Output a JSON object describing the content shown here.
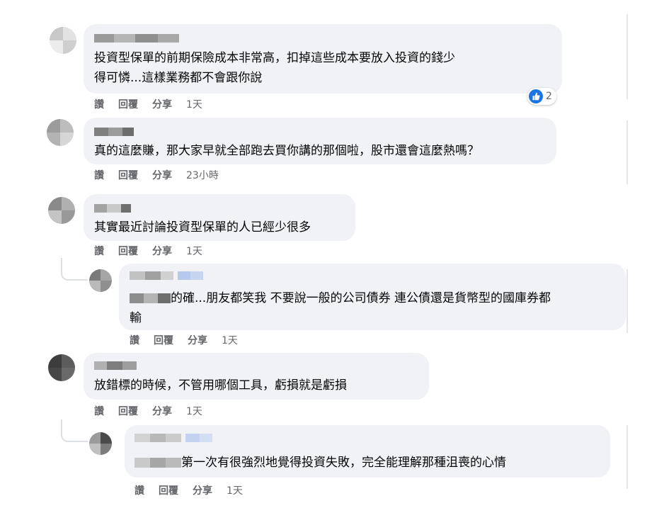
{
  "actions": {
    "like": "讚",
    "reply": "回覆",
    "share": "分享"
  },
  "comments": [
    {
      "text": "投資型保單的前期保險成本非常高，扣掉這些成本要放入投資的錢少\n得可憐...這樣業務都不會跟你說",
      "time": "1天",
      "reactions": {
        "icon": "thumbs-up-icon",
        "count": "2"
      }
    },
    {
      "text": "真的這麼賺，那大家早就全部跑去買你講的那個啦，股市還會這麼熱嗎？",
      "time": "23小時"
    },
    {
      "text": "其實最近討論投資型保單的人已經少很多",
      "time": "1天"
    },
    {
      "text": "的確...朋友都笑我 不要說一般的公司債券 連公債還是貨幣型的國庫券都\n輸",
      "time": "1天"
    },
    {
      "text": "放錯標的時候，不管用哪個工具，虧損就是虧損",
      "time": "1天"
    },
    {
      "text": "第一次有很強烈地覺得投資失敗，完全能理解那種沮喪的心情",
      "time": "1天"
    }
  ],
  "colors": {
    "bubble": "#f0f2f5",
    "meta": "#65676b",
    "like_blue": "#1b74e4"
  }
}
